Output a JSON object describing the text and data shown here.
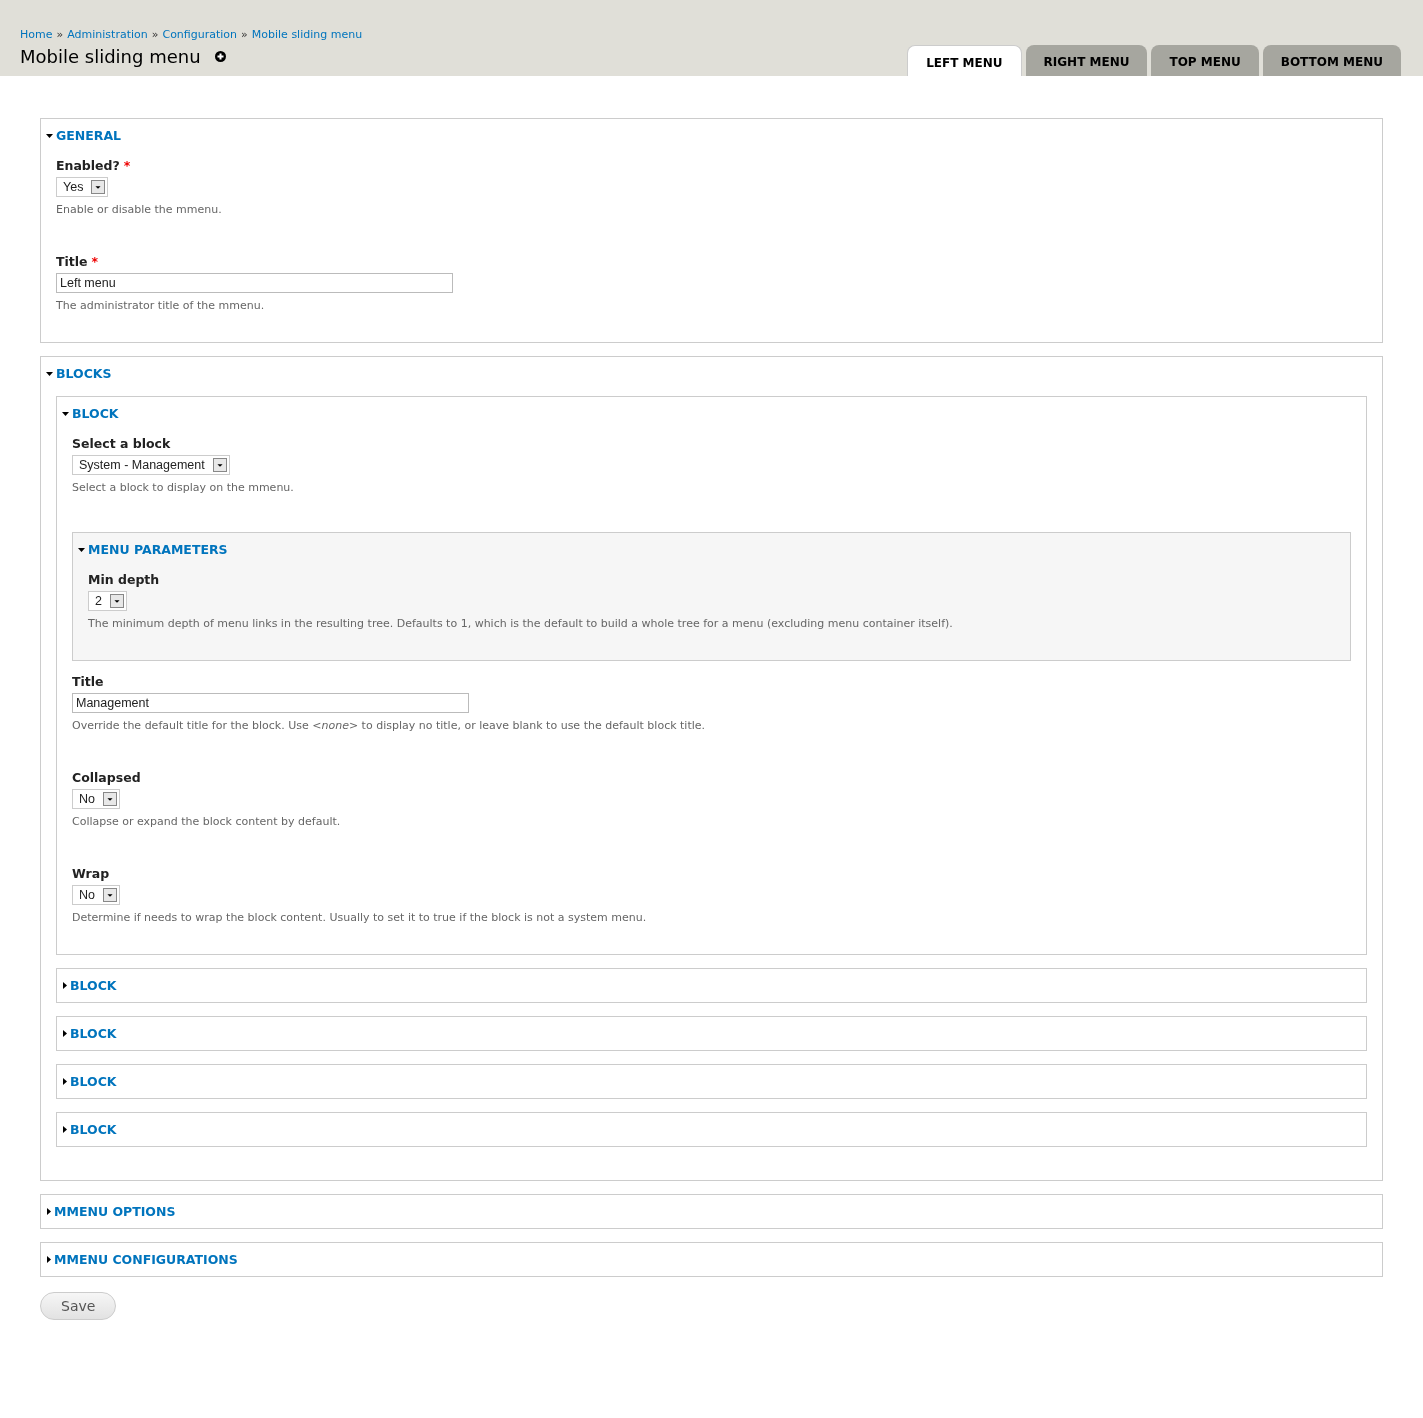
{
  "breadcrumb": [
    "Home",
    "Administration",
    "Configuration",
    "Mobile sliding menu"
  ],
  "breadcrumb_separator": "»",
  "page_title": "Mobile sliding menu",
  "tabs": [
    {
      "label": "LEFT MENU",
      "selected": true
    },
    {
      "label": "RIGHT MENU",
      "selected": false
    },
    {
      "label": "TOP MENU",
      "selected": false
    },
    {
      "label": "BOTTOM MENU",
      "selected": false
    }
  ],
  "fieldsets": [
    {
      "legend": "GENERAL",
      "expanded": true,
      "children": [
        {
          "kind": "select",
          "label": "Enabled?",
          "required_mark": "*",
          "value": "Yes",
          "description": "Enable or disable the mmenu."
        },
        {
          "kind": "text",
          "label": "Title",
          "required_mark": "*",
          "value": "Left menu",
          "description": "The administrator title of the mmenu."
        }
      ]
    },
    {
      "legend": "BLOCKS",
      "expanded": true,
      "children": [
        {
          "kind": "fieldset",
          "legend": "BLOCK",
          "expanded": true,
          "children": [
            {
              "kind": "select",
              "label": "Select a block",
              "value": "System - Management",
              "description": "Select a block to display on the mmenu."
            },
            {
              "kind": "fieldset",
              "legend": "MENU PARAMETERS",
              "expanded": true,
              "children": [
                {
                  "kind": "select",
                  "label": "Min depth",
                  "value": "2",
                  "description": "The minimum depth of menu links in the resulting tree. Defaults to 1, which is the default to build a whole tree for a menu (excluding menu container itself)."
                }
              ]
            },
            {
              "kind": "text",
              "label": "Title",
              "value": "Management",
              "description": "Override the default title for the block. Use *<none>* to display no title, or leave blank to use the default block title."
            },
            {
              "kind": "select",
              "label": "Collapsed",
              "value": "No",
              "description": "Collapse or expand the block content by default."
            },
            {
              "kind": "select",
              "label": "Wrap",
              "value": "No",
              "description": "Determine if needs to wrap the block content. Usually to set it to true if the block is not a system menu."
            }
          ]
        },
        {
          "kind": "fieldset",
          "legend": "BLOCK",
          "expanded": false
        },
        {
          "kind": "fieldset",
          "legend": "BLOCK",
          "expanded": false
        },
        {
          "kind": "fieldset",
          "legend": "BLOCK",
          "expanded": false
        },
        {
          "kind": "fieldset",
          "legend": "BLOCK",
          "expanded": false
        }
      ]
    },
    {
      "legend": "MMENU OPTIONS",
      "expanded": false
    },
    {
      "legend": "MMENU CONFIGURATIONS",
      "expanded": false
    }
  ],
  "save_button": "Save"
}
